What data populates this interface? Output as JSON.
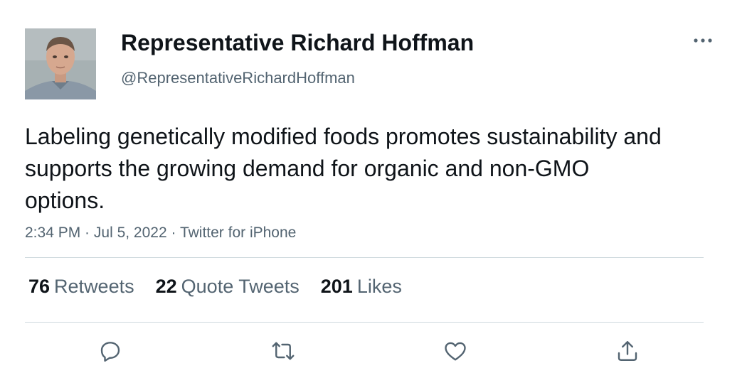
{
  "tweet": {
    "author": {
      "display_name": "Representative Richard Hoffman",
      "handle": "@RepresentativeRichardHoffman",
      "avatar_icon": "profile-photo"
    },
    "more_icon": "more-horizontal-icon",
    "text": "Labeling genetically modified foods promotes sustainability and supports the growing demand for organic and non-GMO options.",
    "meta": {
      "time": "2:34 PM",
      "separator": " · ",
      "date": "Jul 5, 2022",
      "source": "Twitter for iPhone"
    },
    "stats": [
      {
        "count": "76",
        "label": "Retweets"
      },
      {
        "count": "22",
        "label": "Quote Tweets"
      },
      {
        "count": "201",
        "label": "Likes"
      }
    ],
    "actions": [
      {
        "icon": "reply-icon"
      },
      {
        "icon": "retweet-icon"
      },
      {
        "icon": "like-icon"
      },
      {
        "icon": "share-icon"
      }
    ]
  },
  "colors": {
    "text_primary": "#0f1419",
    "text_secondary": "#536471",
    "divider": "#cfd9de"
  }
}
